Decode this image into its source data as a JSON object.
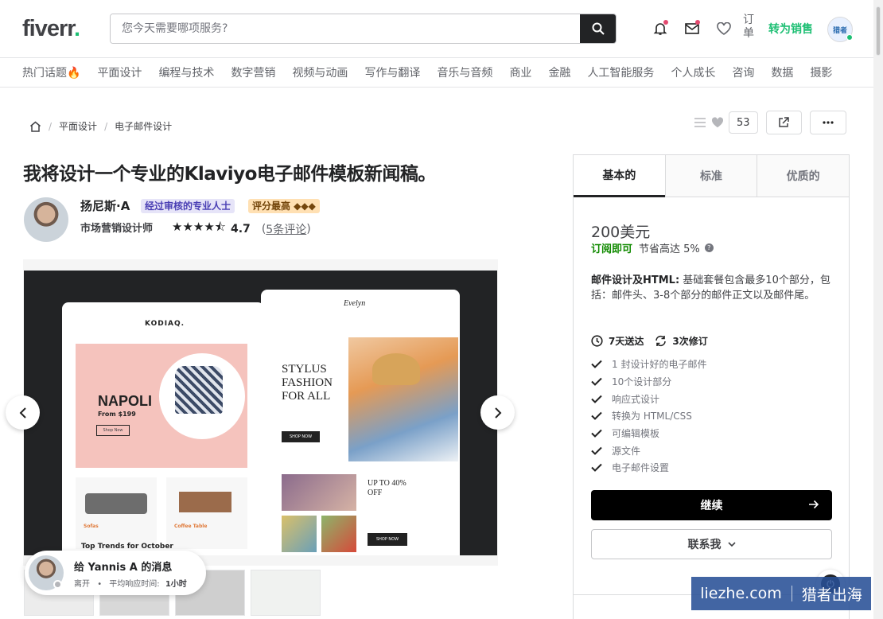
{
  "header": {
    "logo": "fiverr",
    "logo_dot": ".",
    "search_placeholder": "您今天需要哪项服务?",
    "orders_label": "订单",
    "become_seller": "转为销售",
    "avatar_text": "猎者"
  },
  "categories": [
    "热门话题🔥",
    "平面设计",
    "编程与技术",
    "数字营销",
    "视频与动画",
    "写作与翻译",
    "音乐与音频",
    "商业",
    "金融",
    "人工智能服务",
    "个人成长",
    "咨询",
    "数据",
    "摄影"
  ],
  "breadcrumb": {
    "items": [
      "平面设计",
      "电子邮件设计"
    ],
    "separator": "/"
  },
  "actions": {
    "like_count": "53"
  },
  "gig": {
    "title": "我将设计一个专业的Klaviyo电子邮件模板新闻稿。",
    "seller_name": "扬尼斯·A",
    "badge_vetted": "经过审核的专业人士",
    "badge_top": "评分最高 ◆◆◆",
    "seller_role": "市场营销设计师",
    "stars": "★★★★⯪",
    "rating": "4.7",
    "reviews_open": "(",
    "reviews": "5条评论",
    "reviews_close": ")"
  },
  "gallery": {
    "left_brand": "KODIAQ.",
    "napoli": "NAPOLI",
    "price": "From $199",
    "shop_now_small": "Shop Now",
    "sofa": "Sofas",
    "coffee_table": "Coffee Table",
    "trends": "Top Trends for October",
    "right_brand": "Evelyn",
    "stylus": "STYLUS FASHION FOR ALL",
    "shop_now": "SHOP NOW",
    "upto": "UP TO 40% OFF",
    "shop_now2": "SHOP NOW"
  },
  "message_popup": {
    "title": "给 Yannis A 的消息",
    "status": "离开",
    "response_label": "平均响应时间:",
    "response_time": "1小时"
  },
  "package": {
    "tabs": [
      "基本的",
      "标准",
      "优质的"
    ],
    "price": "200美元",
    "subscribe": "订阅即可",
    "save": "节省高达 5%",
    "desc_title": "邮件设计及HTML:",
    "desc_body": " 基础套餐包含最多10个部分，包括：邮件头、3-8个部分的邮件正文以及邮件尾。",
    "delivery": "7天送达",
    "revisions": "3次修订",
    "features": [
      "1 封设计好的电子邮件",
      "10个设计部分",
      "响应式设计",
      "转换为 HTML/CSS",
      "可编辑模板",
      "源文件",
      "电子邮件设置"
    ],
    "continue": "继续",
    "contact": "联系我"
  },
  "watermark": {
    "left": "liezhe.com",
    "right": "猎者出海"
  },
  "colors": {
    "brand_green": "#1dbf73",
    "dark": "#222325",
    "text": "#404145"
  }
}
